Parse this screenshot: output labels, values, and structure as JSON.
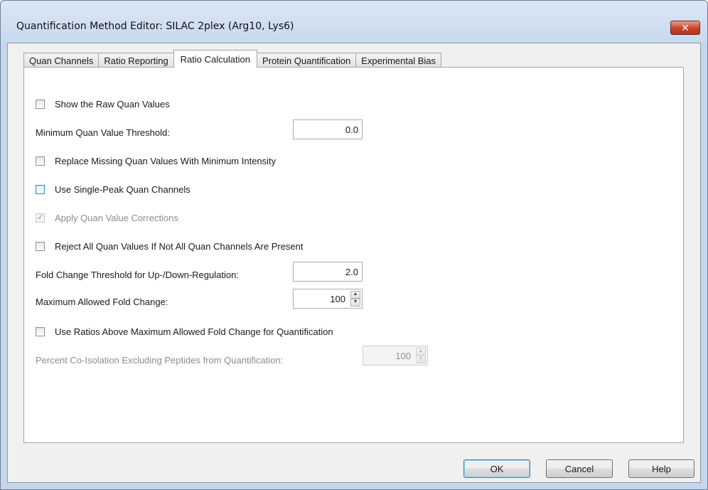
{
  "window": {
    "title": "Quantification Method Editor: SILAC 2plex (Arg10, Lys6)",
    "close_glyph": "✕"
  },
  "tabs": [
    "Quan Channels",
    "Ratio Reporting",
    "Ratio Calculation",
    "Protein Quantification",
    "Experimental Bias"
  ],
  "active_tab": "Ratio Calculation",
  "settings": {
    "show_raw": {
      "label": "Show the Raw Quan Values",
      "checked": false
    },
    "min_threshold": {
      "label": "Minimum Quan Value Threshold:",
      "value": "0.0"
    },
    "replace_missing": {
      "label": "Replace Missing Quan Values With Minimum Intensity",
      "checked": false
    },
    "single_peak": {
      "label": "Use Single-Peak Quan Channels",
      "checked": false
    },
    "apply_corrections": {
      "label": "Apply Quan Value Corrections",
      "checked": true,
      "enabled": false
    },
    "reject_all": {
      "label": "Reject All Quan Values If Not All Quan Channels Are Present",
      "checked": false
    },
    "fold_threshold": {
      "label": "Fold Change Threshold for Up-/Down-Regulation:",
      "value": "2.0"
    },
    "max_fold": {
      "label": "Maximum Allowed Fold Change:",
      "value": "100"
    },
    "use_ratios_above": {
      "label": "Use Ratios Above Maximum Allowed Fold Change for Quantification",
      "checked": false
    },
    "co_isolation": {
      "label": "Percent Co-Isolation Excluding Peptides from Quantification:",
      "value": "100",
      "enabled": false
    }
  },
  "buttons": {
    "ok": "OK",
    "cancel": "Cancel",
    "help": "Help"
  },
  "icons": {
    "spin_up": "▲",
    "spin_down": "▼"
  }
}
